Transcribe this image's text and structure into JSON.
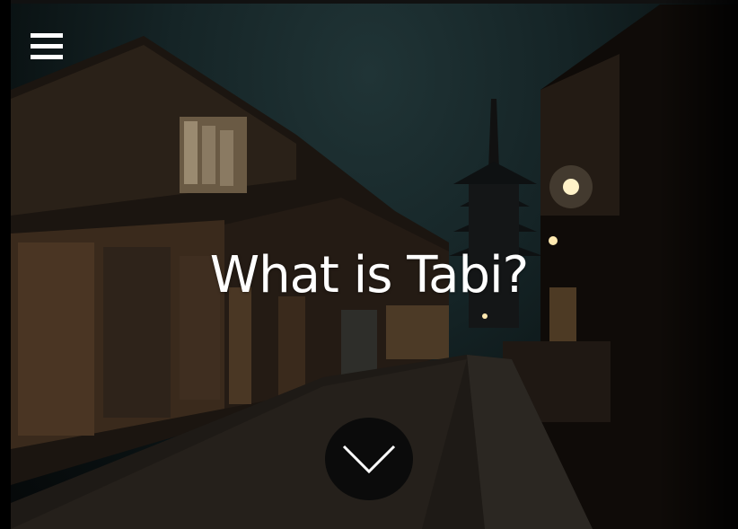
{
  "page": {
    "title": "What is Tabi?"
  },
  "nav": {
    "menu_icon": "hamburger-menu-icon"
  },
  "scroll": {
    "icon": "chevron-down-icon"
  },
  "colors": {
    "text": "#ffffff",
    "button_bg": "#0b0b0b",
    "sky": "#1a2b2d"
  }
}
